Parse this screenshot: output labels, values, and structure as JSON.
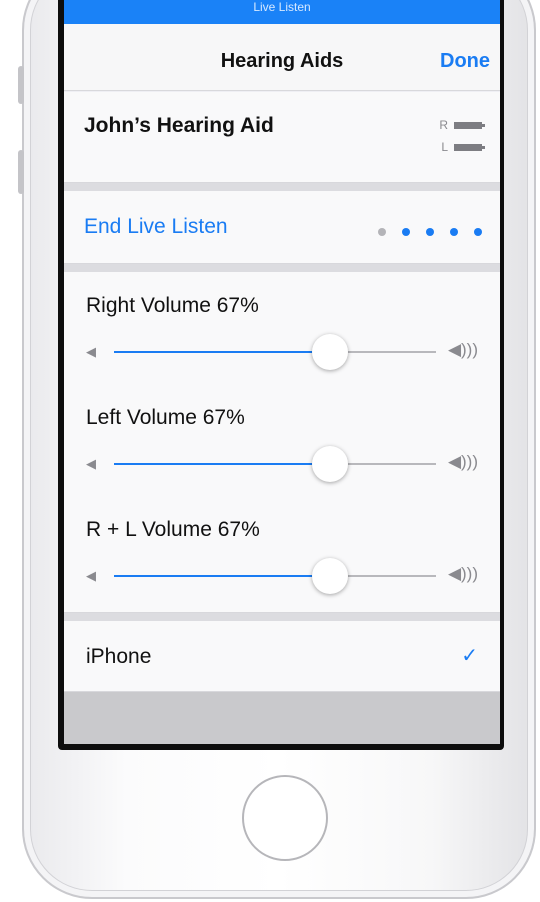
{
  "status_strip": {
    "text": "Live Listen"
  },
  "nav": {
    "title": "Hearing Aids",
    "done": "Done"
  },
  "device": {
    "name": "John’s Hearing Aid",
    "right_label": "R",
    "left_label": "L"
  },
  "live_listen": {
    "label": "End Live Listen",
    "dots_total": 5,
    "dots_active": 4
  },
  "volumes": [
    {
      "label": "Right Volume  67%",
      "value": 0.67
    },
    {
      "label": "Left Volume  67%",
      "value": 0.67
    },
    {
      "label": "R + L Volume  67%",
      "value": 0.67
    }
  ],
  "output": {
    "label": "iPhone",
    "checked_icon": "checkmark-icon"
  },
  "colors": {
    "accent": "#1a7cf3",
    "status_blue": "#1a82f7"
  }
}
